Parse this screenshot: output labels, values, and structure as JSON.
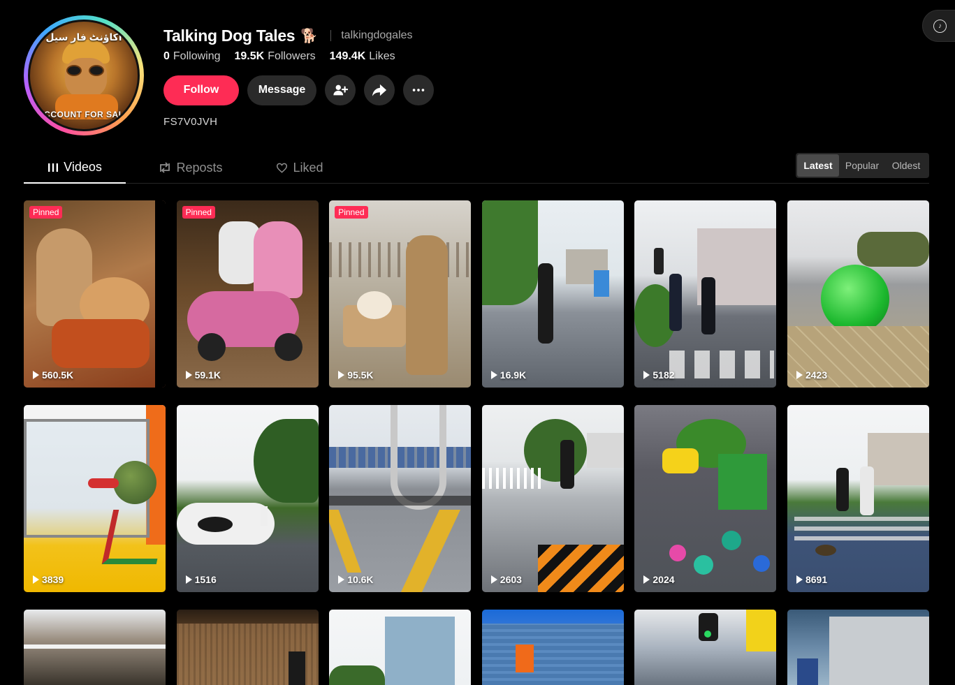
{
  "profile": {
    "title": "Talking Dog Tales",
    "title_emoji": "🐕",
    "handle": "talkingdogales",
    "avatar_text_top": "اکاؤنٹ فار سیل",
    "avatar_text_bottom": "ACCOUNT FOR SALE",
    "stats": {
      "following_count": "0",
      "following_label": "Following",
      "followers_count": "19.5K",
      "followers_label": "Followers",
      "likes_count": "149.4K",
      "likes_label": "Likes"
    },
    "bio": "FS7V0JVH"
  },
  "actions": {
    "follow_label": "Follow",
    "message_label": "Message",
    "icons": [
      "add-friend-icon",
      "share-icon",
      "more-icon"
    ]
  },
  "tabs": [
    {
      "label": "Videos",
      "icon": "grid-icon",
      "active": true
    },
    {
      "label": "Reposts",
      "icon": "repost-icon",
      "active": false
    },
    {
      "label": "Liked",
      "icon": "heart-icon",
      "active": false
    }
  ],
  "sort": {
    "options": [
      "Latest",
      "Popular",
      "Oldest"
    ],
    "selected": "Latest"
  },
  "pinned_label": "Pinned",
  "videos": [
    {
      "views": "560.5K",
      "pinned": true
    },
    {
      "views": "59.1K",
      "pinned": true
    },
    {
      "views": "95.5K",
      "pinned": true
    },
    {
      "views": "16.9K",
      "pinned": false
    },
    {
      "views": "5182",
      "pinned": false
    },
    {
      "views": "2423",
      "pinned": false
    },
    {
      "views": "3839",
      "pinned": false
    },
    {
      "views": "1516",
      "pinned": false
    },
    {
      "views": "10.6K",
      "pinned": false
    },
    {
      "views": "2603",
      "pinned": false
    },
    {
      "views": "2024",
      "pinned": false
    },
    {
      "views": "8691",
      "pinned": false
    }
  ],
  "colors": {
    "accent": "#fe2c55",
    "background": "#000000",
    "button_secondary": "#2a2a2a"
  }
}
